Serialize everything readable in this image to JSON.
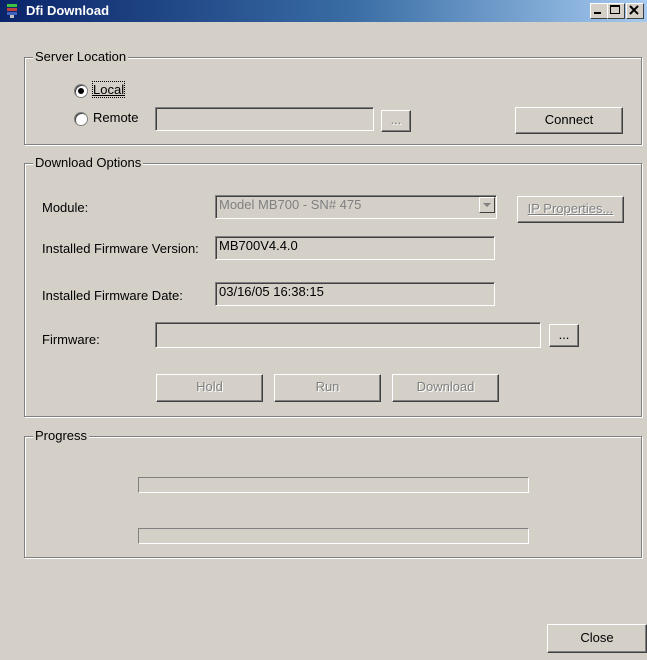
{
  "window": {
    "title": "Dfi Download"
  },
  "server_location": {
    "legend": "Server Location",
    "local_label": "Local",
    "remote_label": "Remote",
    "remote_value": "",
    "browse_label": "...",
    "connect_label": "Connect",
    "selected": "local"
  },
  "download_options": {
    "legend": "Download Options",
    "module_label": "Module:",
    "module_value": "Model MB700 - SN# 475",
    "ip_properties_label": "IP Properties...",
    "firmware_version_label": "Installed Firmware Version:",
    "firmware_version_value": "MB700V4.4.0",
    "firmware_date_label": "Installed Firmware Date:",
    "firmware_date_value": "03/16/05 16:38:15",
    "firmware_label": "Firmware:",
    "firmware_value": "",
    "browse_label": "...",
    "hold_label": "Hold",
    "run_label": "Run",
    "download_label": "Download"
  },
  "progress": {
    "legend": "Progress",
    "bar1_fraction": 0,
    "bar2_fraction": 0
  },
  "footer": {
    "close_label": "Close"
  },
  "colors": {
    "face": "#d4d0c8",
    "title_start": "#0a246a",
    "title_end": "#a6caf0"
  },
  "icons": {
    "app": "app-icon",
    "minimize": "minimize-icon",
    "maximize": "maximize-icon",
    "close": "close-icon"
  }
}
